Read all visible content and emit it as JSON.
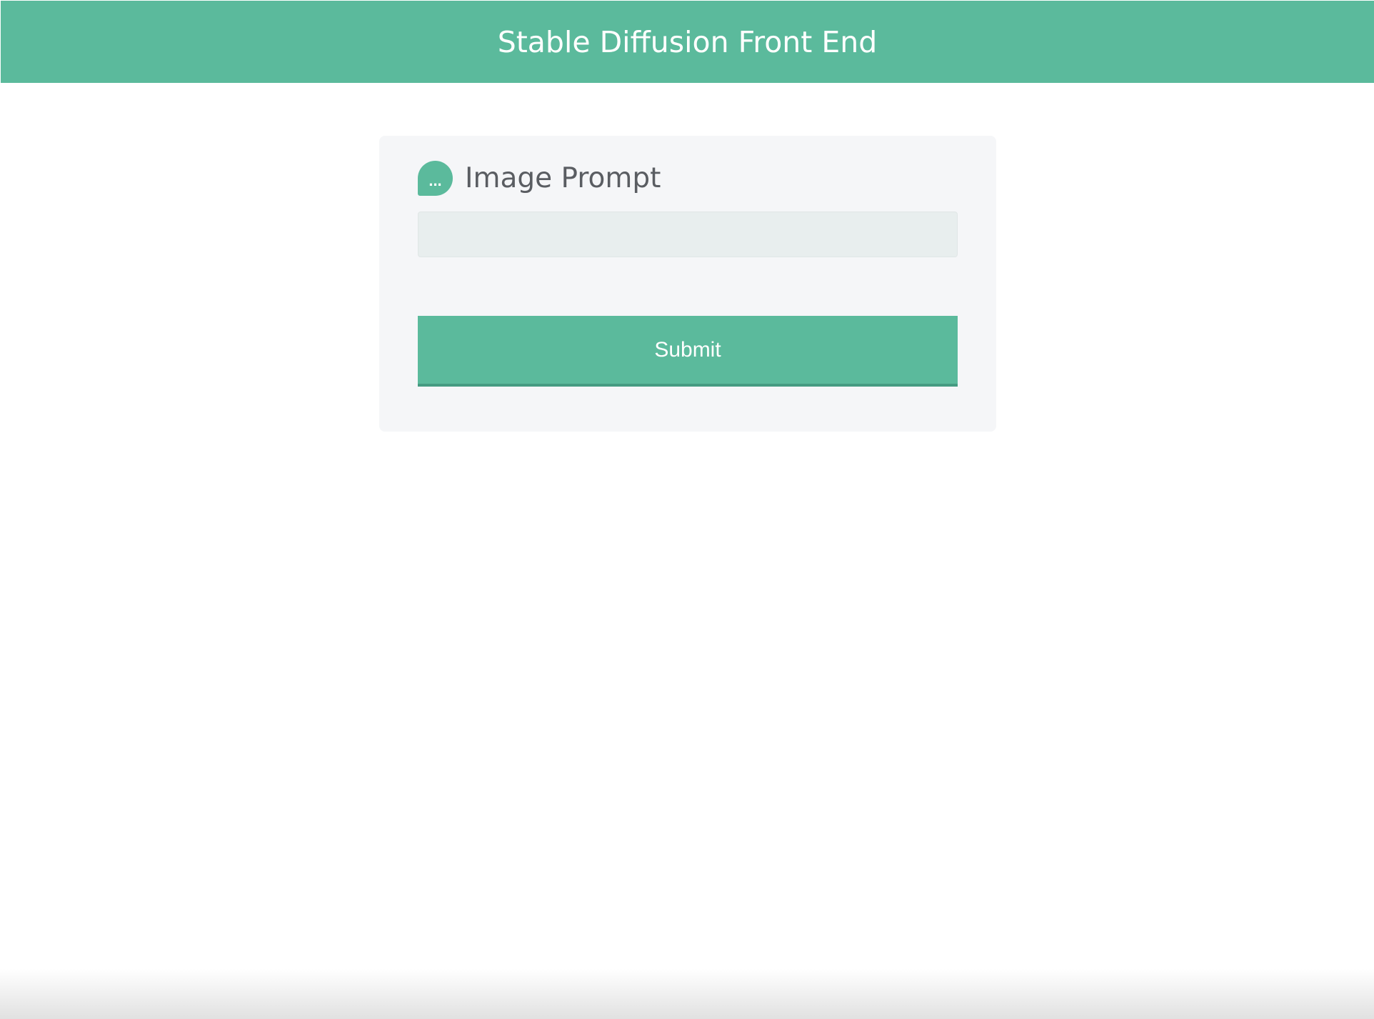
{
  "header": {
    "title": "Stable Diffusion Front End"
  },
  "prompt": {
    "icon": "chat-bubble-icon",
    "icon_glyph": "...",
    "label": "Image Prompt",
    "input_value": "",
    "placeholder": ""
  },
  "actions": {
    "submit_label": "Submit"
  },
  "colors": {
    "accent": "#5bba9c",
    "card_bg": "#f5f6f8",
    "input_bg": "#e8eeee",
    "label_text": "#5a5d62"
  }
}
